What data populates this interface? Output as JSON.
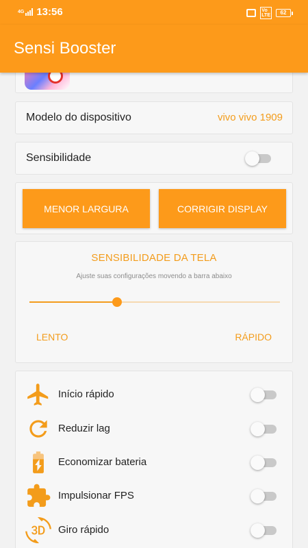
{
  "status_bar": {
    "network": "4G",
    "time": "13:56",
    "volte": "VoLTE",
    "battery": "62"
  },
  "app_bar": {
    "title": "Sensi Booster"
  },
  "device": {
    "label": "Modelo do dispositivo",
    "value": "vivo vivo 1909"
  },
  "sensitivity_toggle": {
    "label": "Sensibilidade",
    "enabled": false
  },
  "buttons": {
    "smaller_width": "MENOR LARGURA",
    "fix_display": "CORRIGIR DISPLAY"
  },
  "screen_sensitivity": {
    "title": "SENSIBILIDADE DA TELA",
    "subtitle": "Ajuste suas configurações movendo a barra abaixo",
    "value_percent": 35,
    "slow_label": "LENTO",
    "fast_label": "RÁPIDO"
  },
  "features": [
    {
      "label": "Início rápido",
      "icon": "airplane-icon",
      "enabled": false
    },
    {
      "label": "Reduzir lag",
      "icon": "refresh-icon",
      "enabled": false
    },
    {
      "label": "Economizar bateria",
      "icon": "battery-charging-icon",
      "enabled": false
    },
    {
      "label": "Impulsionar FPS",
      "icon": "puzzle-icon",
      "enabled": false
    },
    {
      "label": "Giro rápido",
      "icon": "rotate-3d-icon",
      "enabled": false
    }
  ],
  "colors": {
    "accent": "#fd9a1a",
    "accent_text": "#f39c1b",
    "background": "#f2f2f2"
  }
}
